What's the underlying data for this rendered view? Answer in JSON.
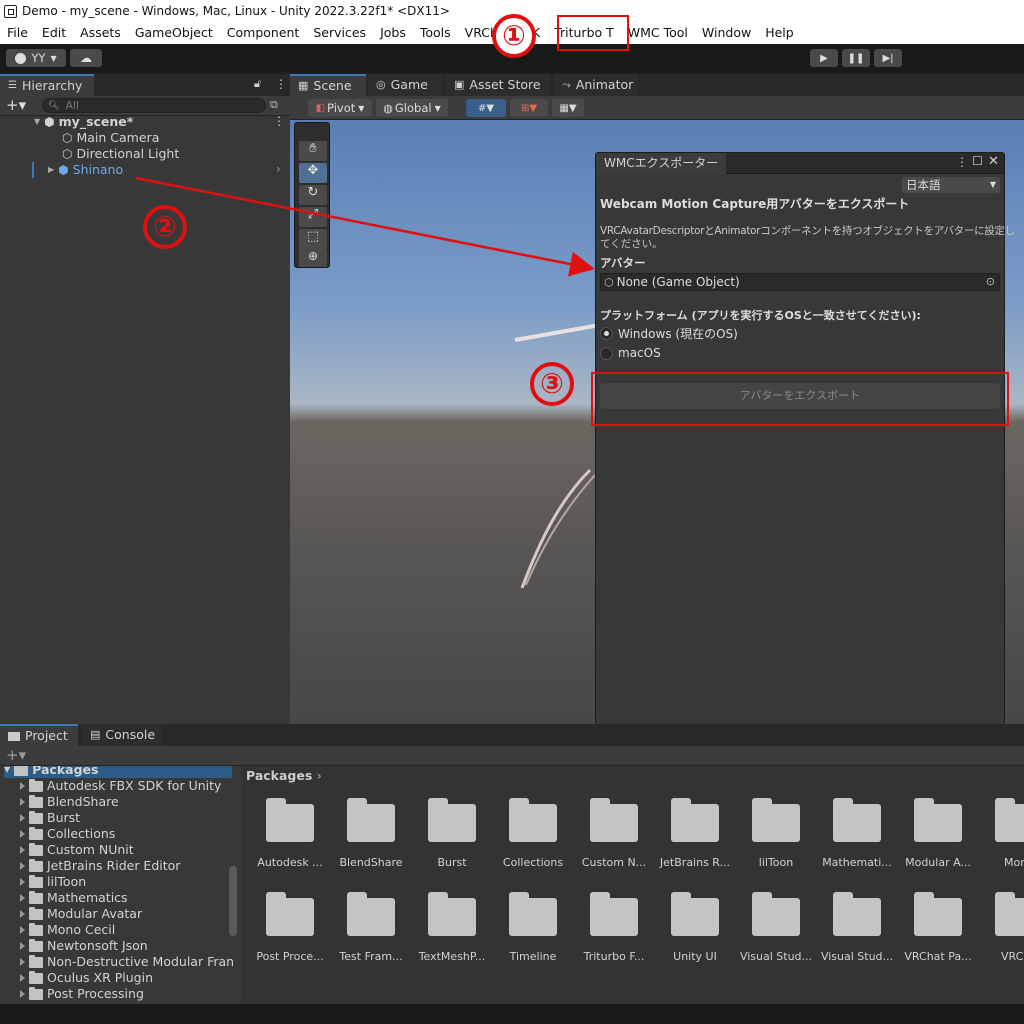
{
  "window": {
    "title": "Demo - my_scene - Windows, Mac, Linux - Unity 2022.3.22f1* <DX11>"
  },
  "menu": [
    "File",
    "Edit",
    "Assets",
    "GameObject",
    "Component",
    "Services",
    "Jobs",
    "Tools",
    "VRChat SDK",
    "Triturbo T",
    "WMC Tool",
    "Window",
    "Help"
  ],
  "toolbar": {
    "account_label": "YY"
  },
  "hierarchy": {
    "tab_label": "Hierarchy",
    "search_placeholder": "All",
    "scene_name": "my_scene*",
    "items": [
      "Main Camera",
      "Directional Light",
      "Shinano"
    ]
  },
  "scene_tabs": [
    "Scene",
    "Game",
    "Asset Store",
    "Animator"
  ],
  "scene_toolbar": {
    "pivot_label": "Pivot",
    "global_label": "Global"
  },
  "wmc_window": {
    "tab_title": "WMCエクスポーター",
    "language": "日本語",
    "heading": "Webcam Motion Capture用アバターをエクスポート",
    "description_line1": "VRCAvatarDescriptorとAnimatorコンポーネントを持つオブジェクトをアバターに設定し",
    "description_line2": "てください。",
    "avatar_label": "アバター",
    "avatar_field_value": "None (Game Object)",
    "platform_label": "プラットフォーム (アプリを実行するOSと一致させてください):",
    "platform_options": [
      "Windows (現在のOS)",
      "macOS"
    ],
    "platform_selected": "Windows (現在のOS)",
    "export_button": "アバターをエクスポート"
  },
  "bottom_tabs": [
    "Project",
    "Console"
  ],
  "project": {
    "root": "Packages",
    "tree": [
      "Autodesk FBX SDK for Unity",
      "BlendShare",
      "Burst",
      "Collections",
      "Custom NUnit",
      "JetBrains Rider Editor",
      "lilToon",
      "Mathematics",
      "Modular Avatar",
      "Mono Cecil",
      "Newtonsoft Json",
      "Non-Destructive Modular Fran",
      "Oculus XR Plugin",
      "Post Processing"
    ],
    "breadcrumb": "Packages",
    "grid_row1": [
      "Autodesk ...",
      "BlendShare",
      "Burst",
      "Collections",
      "Custom N...",
      "JetBrains R...",
      "lilToon",
      "Mathemati...",
      "Modular A...",
      "Mono"
    ],
    "grid_row2": [
      "Post Proce...",
      "Test Fram...",
      "TextMeshP...",
      "Timeline",
      "Triturbo F...",
      "Unity UI",
      "Visual Stud...",
      "Visual Stud...",
      "VRChat Pa...",
      "VRCha"
    ]
  },
  "annotations": {
    "step1": "①",
    "step2": "②",
    "step3": "③",
    "color": "#e01010"
  }
}
